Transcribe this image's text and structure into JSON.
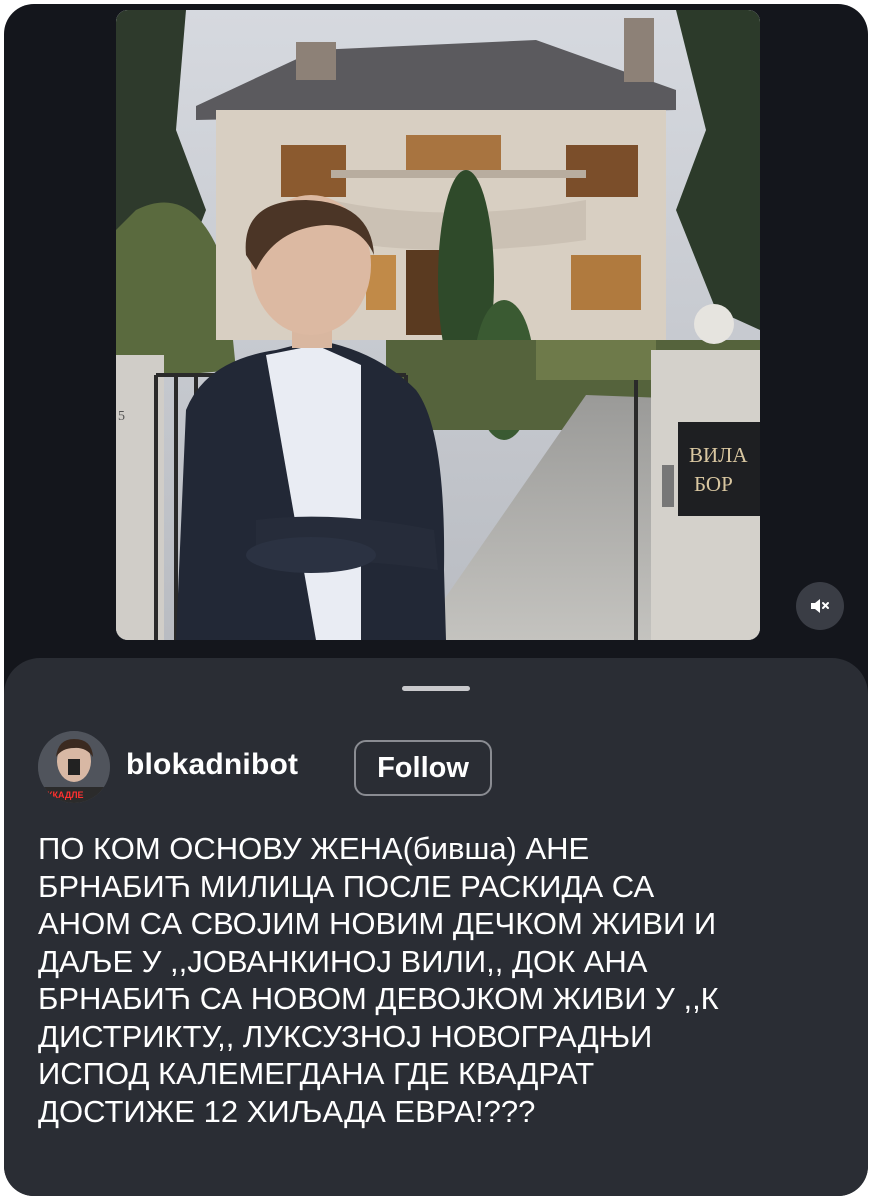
{
  "media": {
    "gate_sign_line1": "ВИЛА",
    "gate_sign_line2": "БОР",
    "gate_number": "5",
    "avatar_badge": "ККАДЛЕ"
  },
  "post": {
    "username": "blokadnibot",
    "follow_label": "Follow",
    "caption": "ПО КОМ ОСНОВУ ЖЕНА(бивша) АНЕ\nБРНАБИЋ МИЛИЦА ПОСЛЕ РАСКИДА СА\nАНОМ  СА СВОЈИМ НОВИМ ДЕЧКОМ ЖИВИ И\nДАЉЕ У ,,ЈОВАНКИНОЈ ВИЛИ,, ДОК АНА\nБРНАБИЋ СА НОВОМ ДЕВОЈКОМ ЖИВИ У ,,К\nДИСТРИКТУ,, ЛУКСУЗНОЈ НОВОГРАДЊИ\nИСПОД КАЛЕМЕГДАНА ГДЕ КВАДРАТ\nДОСТИЖЕ 12 ХИЉАДА ЕВРА!???"
  },
  "icons": {
    "mute": "speaker-muted-icon"
  },
  "colors": {
    "background": "#14161c",
    "sheet": "#2a2d34",
    "text": "#ffffff",
    "follow_border": "#8a8c92"
  }
}
